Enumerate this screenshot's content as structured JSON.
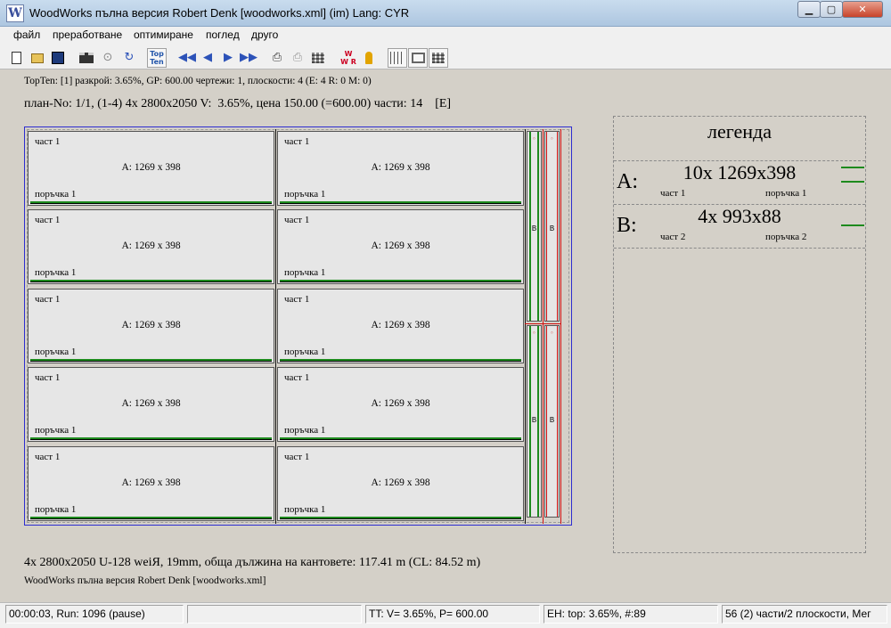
{
  "window": {
    "title": "WoodWorks пълна версия Robert Denk [woodworks.xml] (im) Lang: CYR",
    "icon": "W",
    "controls": [
      "minimize-icon",
      "maximize-icon",
      "close-icon"
    ]
  },
  "menu": [
    "файл",
    "преработване",
    "оптимиране",
    "поглед",
    "друго"
  ],
  "toolbar": {
    "icons": [
      "new-document-icon",
      "open-folder-icon",
      "save-disk-icon",
      "film-icon",
      "settings-circle-icon",
      "refresh-icon",
      "topten-icon",
      "first-icon",
      "previous-icon",
      "next-icon",
      "last-icon",
      "print-icon",
      "print-preview-icon",
      "grid-icon",
      "wwr-icon",
      "key-icon",
      "sliders-icon",
      "frame-icon",
      "layout-icon"
    ],
    "topten_label": "Top Ten",
    "wwr_label": "W W R",
    "arrows": [
      "◀◀",
      "◀",
      "▶",
      "▶▶"
    ]
  },
  "info_line1": "TopTen: [1] разкрой:  3.65%, GP: 600.00 чертежи: 1, плоскости: 4 (E: 4 R: 0 M: 0)",
  "info_line2": "план-No: 1/1, (1-4) 4x 2800x2050 V:  3.65%, цена 150.00 (=600.00) части: 14    [E]",
  "plan": {
    "parts": [
      {
        "name": "част 1",
        "size": "A: 1269 x 398",
        "order": "поръчка 1"
      },
      {
        "name": "част 1",
        "size": "A: 1269 x 398",
        "order": "поръчка 1"
      },
      {
        "name": "част 1",
        "size": "A: 1269 x 398",
        "order": "поръчка 1"
      },
      {
        "name": "част 1",
        "size": "A: 1269 x 398",
        "order": "поръчка 1"
      },
      {
        "name": "част 1",
        "size": "A: 1269 x 398",
        "order": "поръчка 1"
      },
      {
        "name": "част 1",
        "size": "A: 1269 x 398",
        "order": "поръчка 1"
      },
      {
        "name": "част 1",
        "size": "A: 1269 x 398",
        "order": "поръчка 1"
      },
      {
        "name": "част 1",
        "size": "A: 1269 x 398",
        "order": "поръчка 1"
      },
      {
        "name": "част 1",
        "size": "A: 1269 x 398",
        "order": "поръчка 1"
      },
      {
        "name": "част 1",
        "size": "A: 1269 x 398",
        "order": "поръчка 1"
      }
    ],
    "strip_label": "B"
  },
  "legend": {
    "title": "легенда",
    "rows": [
      {
        "letter": "A:",
        "main": "10x 1269x398",
        "part": "част 1",
        "order": "поръчка 1"
      },
      {
        "letter": "B:",
        "main": "4x 993x88",
        "part": "част 2",
        "order": "поръчка 2"
      }
    ]
  },
  "summary": "4x 2800x2050 U-128 weiЯ, 19mm, обща дължина на кантовете: 117.41 m (CL: 84.52 m)",
  "footer": "WoodWorks пълна версия Robert Denk [woodworks.xml]",
  "status": [
    "00:00:03, Run: 1096 (pause)",
    "",
    "TT: V= 3.65%, P= 600.00",
    "EH: top: 3.65%,  #:89",
    "56 (2) части/2 плоскости, Мег"
  ]
}
